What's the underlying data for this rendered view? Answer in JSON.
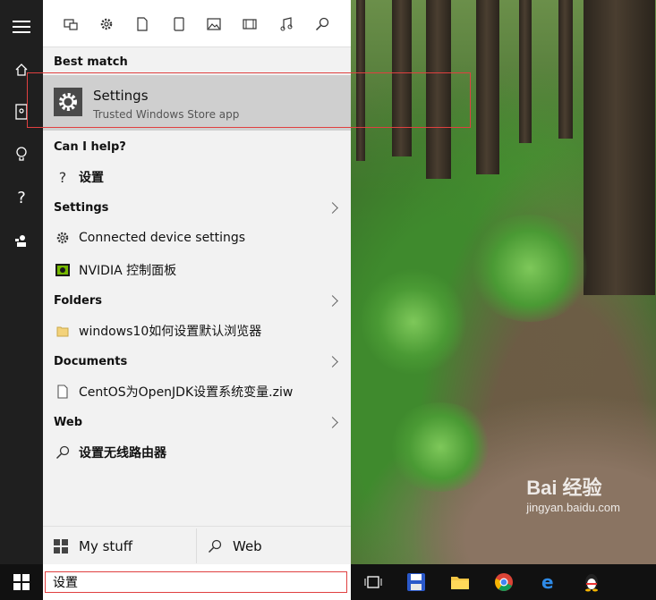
{
  "filter_bar": {
    "icons": [
      "apps-icon",
      "settings-filter-icon",
      "documents-icon",
      "phone-icon",
      "photos-icon",
      "videos-icon",
      "music-icon",
      "web-search-icon"
    ]
  },
  "left_rail": {
    "icons": [
      "hamburger-menu-icon",
      "home-icon",
      "notebook-icon",
      "lightbulb-icon",
      "help-icon",
      "feedback-icon"
    ]
  },
  "best_match": {
    "heading": "Best match",
    "title": "Settings",
    "subtitle": "Trusted Windows Store app"
  },
  "help": {
    "heading": "Can I help?",
    "item": "设置"
  },
  "settings": {
    "heading": "Settings",
    "items": [
      "Connected device settings",
      "NVIDIA 控制面板"
    ]
  },
  "folders": {
    "heading": "Folders",
    "items": [
      "windows10如何设置默认浏览器"
    ]
  },
  "documents": {
    "heading": "Documents",
    "items": [
      "CentOS为OpenJDK设置系统变量.ziw"
    ]
  },
  "web": {
    "heading": "Web",
    "items": [
      "设置无线路由器"
    ]
  },
  "bottom": {
    "my_stuff": "My stuff",
    "web": "Web"
  },
  "search": {
    "value": "设置"
  },
  "watermark": {
    "brand": "Bai 经验",
    "url": "jingyan.baidu.com"
  },
  "colors": {
    "taskbar": "#111111",
    "panel": "#f2f2f2",
    "selection": "#cfcfcf",
    "highlight_border": "#e04040"
  }
}
